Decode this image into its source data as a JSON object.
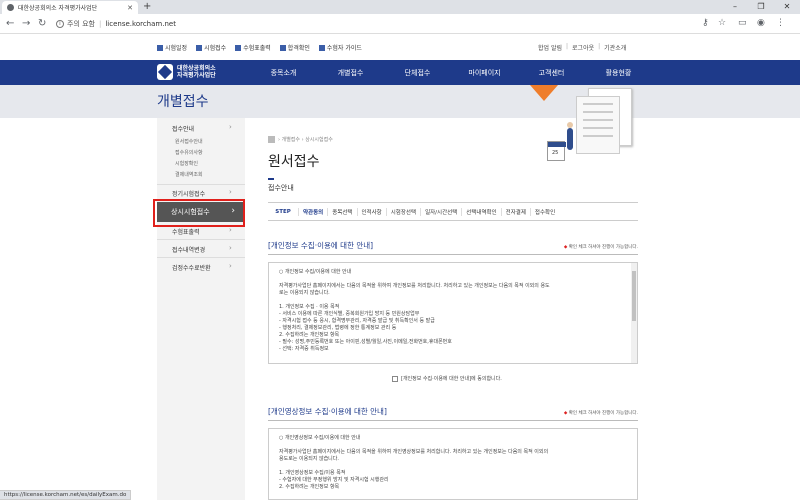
{
  "browser": {
    "tab_title": "대한상공회의소 자격평가사업단",
    "new_tab": "+",
    "url_security": "주의 요함",
    "url": "license.korcham.net",
    "status_url": "https://license.korcham.net/es/dailyExam.do"
  },
  "util_nav": {
    "items": [
      "시험일정",
      "시험접수",
      "수험표출력",
      "합격확인",
      "수험자 가이드"
    ],
    "right": [
      "합업 알림",
      "로그아웃",
      "기관소개"
    ]
  },
  "logo": {
    "line1": "대한상공회의소",
    "line2": "자격평가사업단"
  },
  "gnb": [
    "종목소개",
    "개별접수",
    "단체접수",
    "마이페이지",
    "고객센터",
    "활용현황"
  ],
  "hero": {
    "title": "개별접수",
    "calendar_number": "25"
  },
  "lnb": {
    "group1": "접수안내",
    "group1_subs": [
      "원서접수안내",
      "접수유의사항",
      "시험장확인",
      "결제내역조회"
    ],
    "group2": "정기시험접수",
    "active": "상시시험접수",
    "group3": "수험표출력",
    "group4": "접수내역변경",
    "group5": "검정수수료반환",
    "arrow": "›"
  },
  "main": {
    "breadcrumb": [
      "개별접수",
      "상시시험접수"
    ],
    "title": "원서접수",
    "subtitle": "접수안내",
    "steps_label": "STEP",
    "steps": [
      "약관동의",
      "종목선택",
      "인적사항",
      "시험장선택",
      "일자/시간선택",
      "선택내역확인",
      "전자결제",
      "접수확인"
    ]
  },
  "section1": {
    "title": "[개인정보 수집·이용에 대한 안내]",
    "note": "확인 체크 하셔야 진행이 가능합니다.",
    "lines": [
      "○ 개인정보 수집/이용에 대한 안내",
      "",
      "자격평가사업단 홈페이지에서는 다음의 목적을 위하여 개인정보를 처리합니다. 처리하고 있는 개인정보는 다음의 목적 이외의 용도",
      "로는 이용되지 않습니다.",
      "",
      "1. 개인정보 수집 · 이용 목적",
      "- 서비스 이용에 따른 개인식별, 중복회원가입 방지 등 민원상담업무",
      "- 자격시험 접수 등 응시, 합격명부관리, 자격증 발급 및 취득확인서 등 발급",
      "- 행정처리, 결제정보관리, 법령에 정한 통계정보 관리 등",
      "2. 수집하려는 개인정보 항목",
      "- 필수: 성명,주민등록번호 또는 아이핀,성별/월일,사진,이메일,전화번호,휴대폰번호",
      "- 선택: 자격증 취득정보"
    ],
    "agree": "[개인정보 수집·이용에 대한 안내]에 동의합니다."
  },
  "section2": {
    "title": "[개인영상정보 수집·이용에 대한 안내]",
    "note": "확인 체크 하셔야 진행이 가능합니다.",
    "lines": [
      "○ 개인영상정보 수집/이용에 대한 안내",
      "",
      "자격평가사업단 홈페이지에서는 다음의 목적을 위하여 개인영상정보를 처리합니다. 처리하고 있는 개인정보는 다음의 목적 이외의",
      "용도로는 이용되지 않습니다.",
      "",
      "1. 개인영상정보 수집/이용 목적",
      "- 수험자에 대한 부정행위 방지 및 자격시험 시행관리",
      "2. 수집하려는 개인정보 항목"
    ]
  }
}
